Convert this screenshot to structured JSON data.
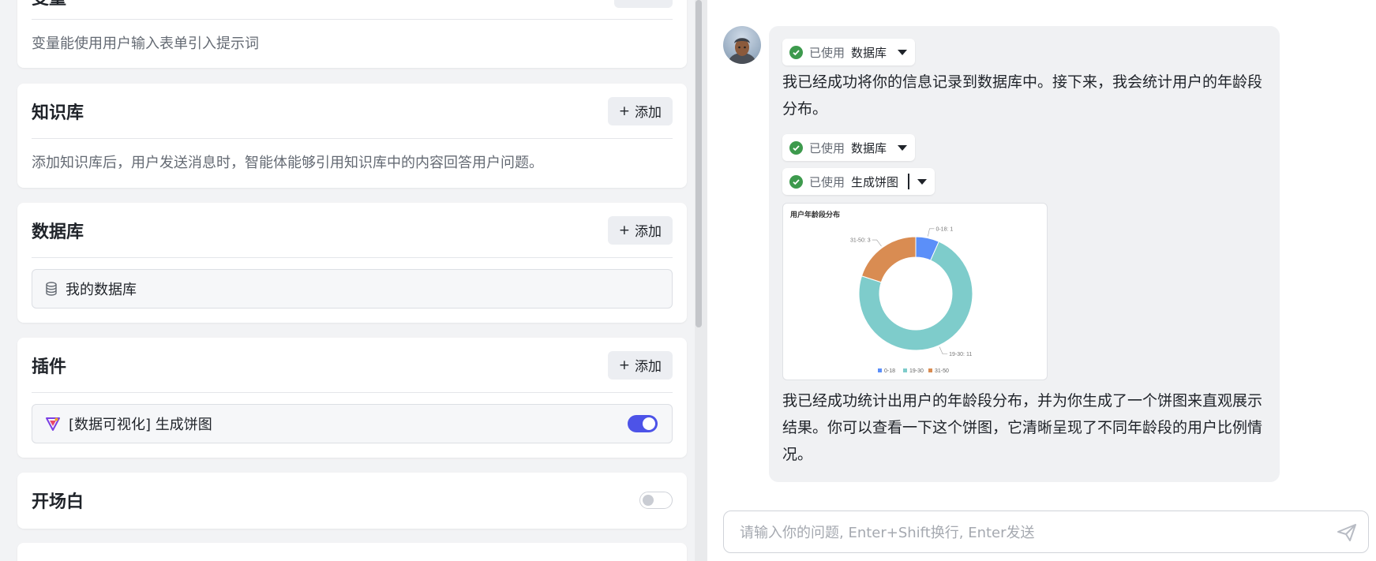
{
  "config": {
    "variables": {
      "title": "变量",
      "description": "变量能使用用户输入表单引入提示词"
    },
    "knowledge": {
      "title": "知识库",
      "add_label": "添加",
      "description": "添加知识库后，用户发送消息时，智能体能够引用知识库中的内容回答用户问题。"
    },
    "database": {
      "title": "数据库",
      "add_label": "添加",
      "item": "我的数据库"
    },
    "plugins": {
      "title": "插件",
      "add_label": "添加",
      "item": "[数据可视化] 生成饼图",
      "enabled": true
    },
    "opening": {
      "title": "开场白",
      "enabled": false
    }
  },
  "chat": {
    "tool_calls": [
      {
        "status": "已使用",
        "name": "数据库"
      },
      {
        "status": "已使用",
        "name": "数据库"
      },
      {
        "status": "已使用",
        "name": "生成饼图"
      }
    ],
    "message_1": "我已经成功将你的信息记录到数据库中。接下来，我会统计用户的年龄段分布。",
    "message_2": "我已经成功统计出用户的年龄段分布，并为你生成了一个饼图来直观展示结果。你可以查看一下这个饼图，它清晰呈现了不同年龄段的用户比例情况。",
    "input_placeholder": "请输入你的问题, Enter+Shift换行, Enter发送"
  },
  "chart_data": {
    "type": "pie",
    "title": "用户年龄段分布",
    "donut": true,
    "categories": [
      "0-18",
      "19-30",
      "31-50"
    ],
    "values": [
      1,
      11,
      3
    ],
    "slice_labels": [
      "0-18: 1",
      "19-30: 11",
      "31-50: 3"
    ],
    "colors": [
      "#5b8ff9",
      "#7ecccb",
      "#d98c52"
    ],
    "legend_position": "bottom"
  },
  "colors": {
    "accent": "#4d53e8",
    "success": "#3d9a4d",
    "panel_bg": "#f2f3f5",
    "bubble_bg": "#f0f1f3"
  }
}
